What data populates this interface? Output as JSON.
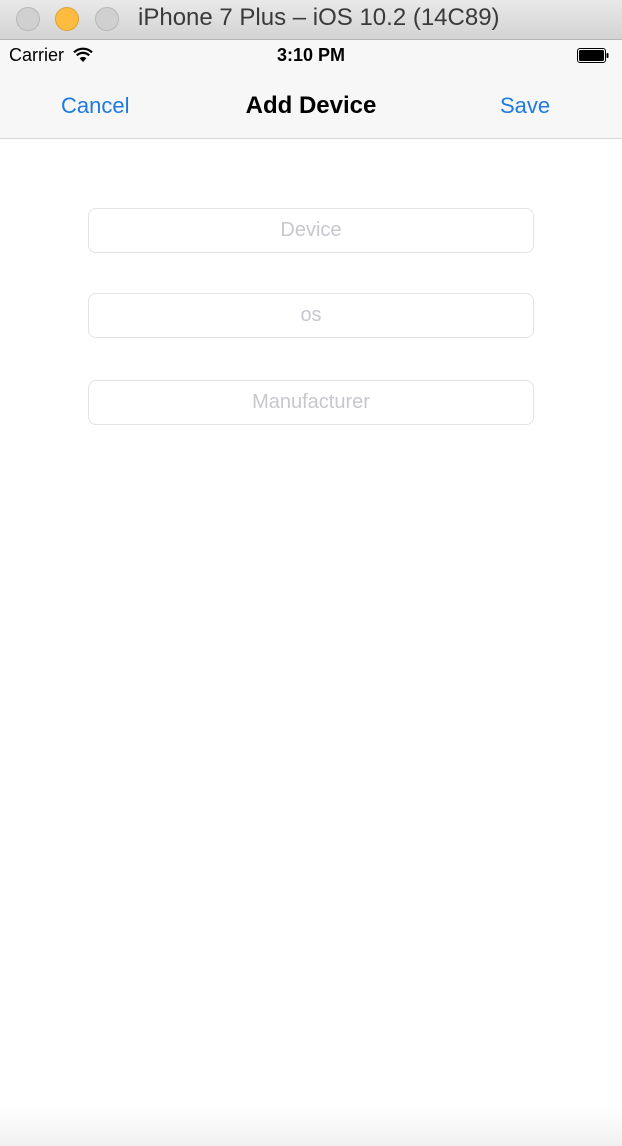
{
  "window": {
    "title": "iPhone 7 Plus – iOS 10.2 (14C89)"
  },
  "status_bar": {
    "carrier": "Carrier",
    "time": "3:10 PM",
    "icons": [
      "wifi-icon",
      "battery-icon"
    ]
  },
  "nav": {
    "cancel_label": "Cancel",
    "title": "Add Device",
    "save_label": "Save",
    "accent_color": "#1f7ae0"
  },
  "form": {
    "device": {
      "placeholder": "Device",
      "value": ""
    },
    "os": {
      "placeholder": "os",
      "value": ""
    },
    "manufacturer": {
      "placeholder": "Manufacturer",
      "value": ""
    }
  }
}
